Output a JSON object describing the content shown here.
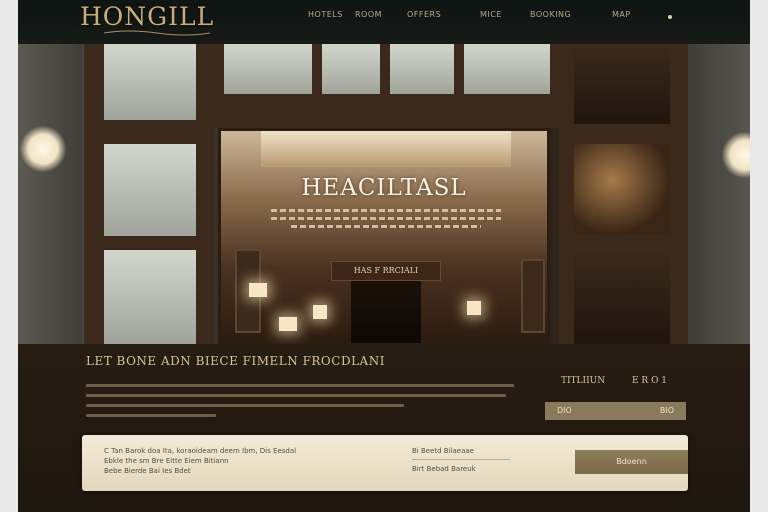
{
  "brand": {
    "logo": "HONGILL"
  },
  "nav": {
    "items": [
      {
        "label": "HOTELS"
      },
      {
        "label": "ROOM"
      },
      {
        "label": "OFFERS"
      },
      {
        "label": "MICE"
      },
      {
        "label": "BOOKING"
      },
      {
        "label": "MAP"
      }
    ]
  },
  "hero": {
    "sign": "HEACILTASL",
    "inner_sign": "HAS F RRCIALI"
  },
  "info": {
    "heading": "LET BONE ADN BIECE FIMELN FROCDLANI",
    "price_label": "TITLIIUN",
    "price_value": "E R O  1",
    "select": {
      "left": "DIO",
      "right": "BIO"
    }
  },
  "booking": {
    "line1": "C Tan Barok doa Ita, koraoideam deem Ibm, Dis Eesdal",
    "line2": "Ebkle the sm Bre Eitte Eiem Bitiann",
    "line3": "Bebe Bierde Bai Ies Bdet",
    "field": "Bi Beetd Bilaeaae",
    "field2": "Birt Bebad Bareuk",
    "button": "Bdoenn"
  },
  "colors": {
    "accent": "#8a7a5c",
    "card": "#f2ebd8",
    "heading": "#d8c29a"
  }
}
